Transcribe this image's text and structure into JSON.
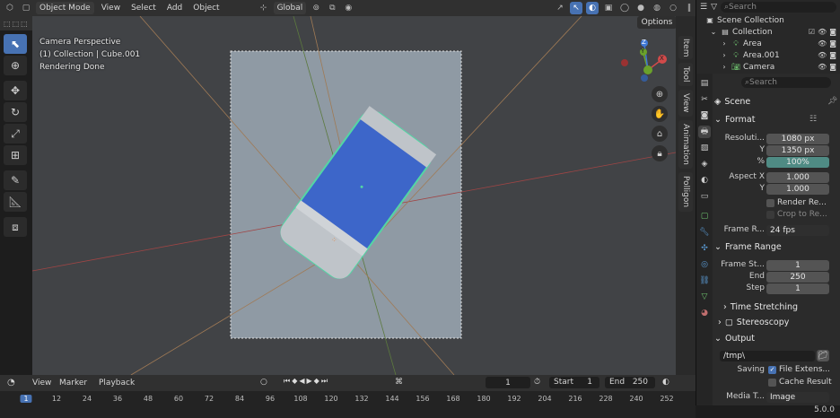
{
  "topbar": {
    "mode": "Object Mode",
    "menus": [
      "View",
      "Select",
      "Add",
      "Object"
    ],
    "orientation": "Global",
    "options": "Options"
  },
  "overlay": {
    "line1": "Camera Perspective",
    "line2": "(1) Collection | Cube.001",
    "line3": "Rendering Done"
  },
  "gizmo": {
    "x": "X",
    "y": "Y",
    "z": "Z"
  },
  "sidetabs": [
    "Item",
    "Tool",
    "View",
    "Animation",
    "Polligon"
  ],
  "outliner": {
    "search_placeholder": "Search",
    "root": "Scene Collection",
    "collection": "Collection",
    "items": [
      "Area",
      "Area.001",
      "Camera"
    ]
  },
  "properties": {
    "search_placeholder": "Search",
    "scene": "Scene",
    "format": {
      "title": "Format",
      "res_label": "Resoluti...",
      "res_x": "1080 px",
      "y_label": "Y",
      "res_y": "1350 px",
      "pct_label": "%",
      "pct": "100%",
      "aspect_label": "Aspect X",
      "aspect_x": "1.000",
      "aspect_y": "1.000",
      "render_region": "Render Re...",
      "crop": "Crop to Re...",
      "frame_rate_label": "Frame R...",
      "frame_rate": "24 fps"
    },
    "frame_range": {
      "title": "Frame Range",
      "start_label": "Frame St...",
      "start": "1",
      "end_label": "End",
      "end": "250",
      "step_label": "Step",
      "step": "1"
    },
    "time_stretching": "Time Stretching",
    "stereoscopy": "Stereoscopy",
    "output": {
      "title": "Output",
      "path": "/tmp\\",
      "saving_label": "Saving",
      "file_ext": "File Extens...",
      "cache": "Cache Result",
      "media_label": "Media T...",
      "media": "Image"
    }
  },
  "timeline": {
    "menus": [
      "View",
      "Marker",
      "Playback"
    ],
    "current": "1",
    "start_label": "Start",
    "start": "1",
    "end_label": "End",
    "end": "250",
    "ticks": [
      "1",
      "12",
      "24",
      "36",
      "48",
      "60",
      "72",
      "84",
      "96",
      "108",
      "120",
      "132",
      "144",
      "156",
      "168",
      "180",
      "192",
      "204",
      "216",
      "228",
      "240",
      "252"
    ]
  },
  "status": {
    "version": "5.0.0"
  },
  "colors": {
    "accent": "#4772b3",
    "object_outline": "#53d6a4",
    "object_blue": "#3d66c9"
  }
}
